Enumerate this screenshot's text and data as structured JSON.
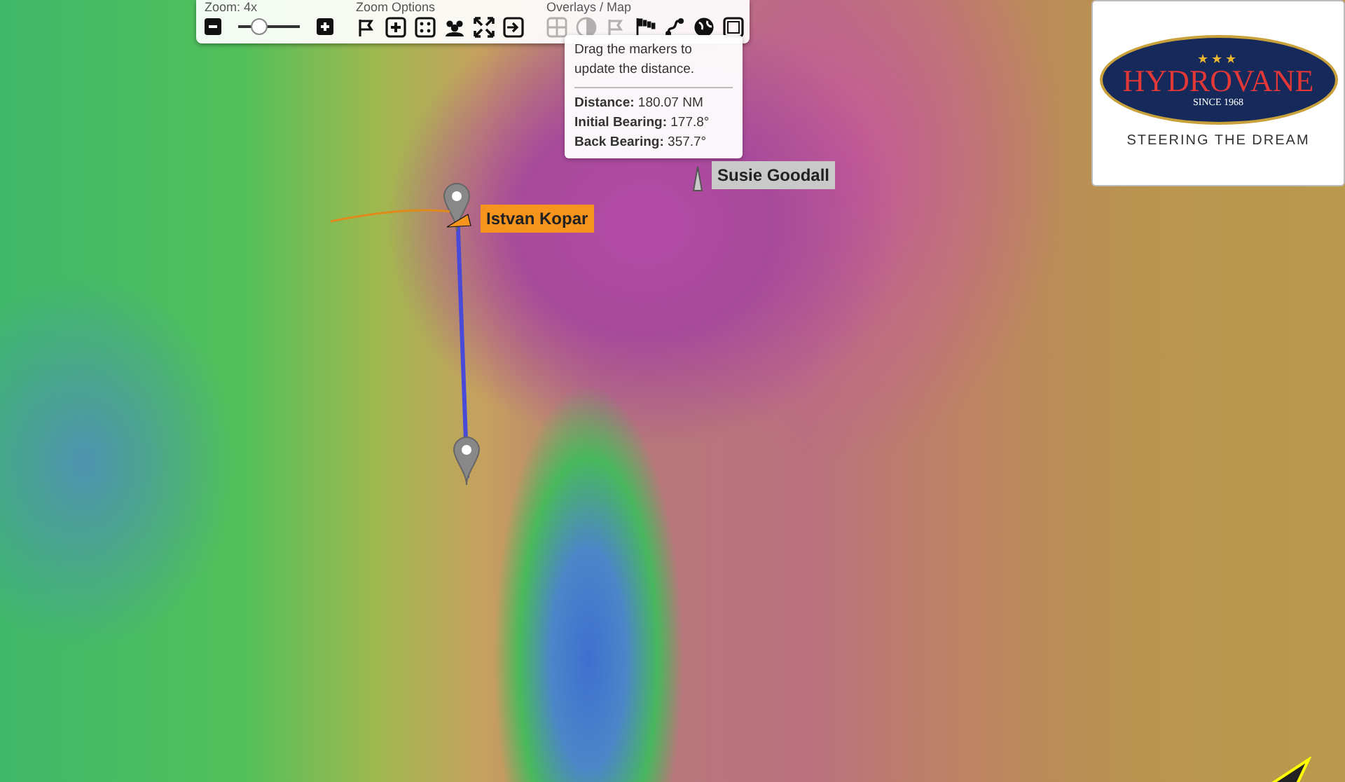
{
  "toolbar": {
    "zoom": {
      "heading": "Zoom: 4x",
      "level": 0.35
    },
    "zoom_options": {
      "heading": "Zoom Options",
      "tools": [
        {
          "kind": "flag",
          "disabled": false
        },
        {
          "kind": "plus",
          "disabled": false
        },
        {
          "kind": "dice",
          "disabled": false
        },
        {
          "kind": "group",
          "disabled": false
        },
        {
          "kind": "expand",
          "disabled": false
        },
        {
          "kind": "exit",
          "disabled": false
        }
      ]
    },
    "overlays": {
      "heading": "Overlays / Map",
      "tools": [
        {
          "kind": "grid",
          "disabled": true
        },
        {
          "kind": "half",
          "disabled": true
        },
        {
          "kind": "flag",
          "disabled": true
        },
        {
          "kind": "flags",
          "disabled": false
        },
        {
          "kind": "route",
          "disabled": false
        },
        {
          "kind": "globe",
          "disabled": false
        },
        {
          "kind": "frame",
          "disabled": false
        }
      ]
    }
  },
  "distance_popup": {
    "hint": "Drag the markers to update the distance.",
    "rows": [
      {
        "label": "Distance:",
        "value": "180.07 NM"
      },
      {
        "label": "Initial Bearing:",
        "value": "177.8°"
      },
      {
        "label": "Back Bearing:",
        "value": "357.7°"
      }
    ]
  },
  "sponsor": {
    "stars": "★★★",
    "brand": "HYDROVANE",
    "since": "SINCE 1968",
    "tagline": "STEERING THE DREAM"
  },
  "boats": [
    {
      "name": "Istvan Kopar",
      "color": "#f7941d"
    },
    {
      "name": "Susie Goodall",
      "color": "#c9c9c9"
    }
  ]
}
